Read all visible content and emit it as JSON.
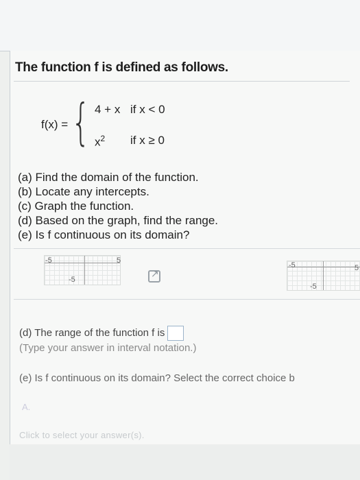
{
  "problem": {
    "title": "The function f is defined as follows.",
    "fx_label": "f(x) =",
    "case1_expr": "4 + x",
    "case1_cond": "if x < 0",
    "case2_base": "x",
    "case2_exp": "2",
    "case2_cond": "if x ≥ 0",
    "questions": [
      "(a) Find the domain of the function.",
      "(b) Locate any intercepts.",
      "(c) Graph the function.",
      "(d) Based on the graph, find the range.",
      "(e) Is f continuous on its domain?"
    ]
  },
  "graphs": {
    "left_neg": "-5",
    "left_pos": "5",
    "left_bottom": "-5",
    "right_neg": "-5",
    "right_pos": "5",
    "right_bottom": "-5"
  },
  "answers": {
    "part_d_text": "(d) The range of the function f is",
    "part_d_hint": "(Type your answer in interval notation.)",
    "part_e_text": "(e) Is f continuous on its domain? Select the correct choice b",
    "choice_a": "A.",
    "footer_hint": "Click to select your answer(s)."
  }
}
